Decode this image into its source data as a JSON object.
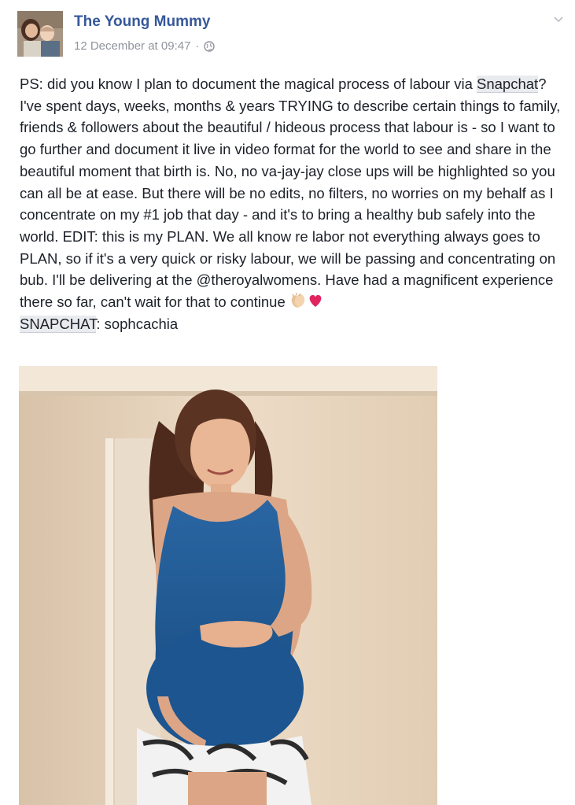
{
  "post": {
    "author": "The Young Mummy",
    "timestamp": "12 December at 09:47",
    "separator": "·",
    "text_parts": {
      "p1": "PS: did you know I plan to document the magical process of labour via ",
      "tag1": "Snapchat",
      "p2": "? I've spent days, weeks, months & years TRYING to describe certain things to family, friends & followers about the beautiful / hideous process that labour is - so I want to go further and document it live in video format for the world to see and share in the beautiful moment that birth is. No, no va-jay-jay close ups will be highlighted so you can all be at ease. But there will be no edits, no filters, no worries on my behalf as I concentrate on my #1 job that day - and it's to bring a healthy bub safely into the world. EDIT: this is my PLAN. We all know re labor not everything always goes to PLAN, so if it's a very quick or risky labour, we will be passing and concentrating on bub. I'll be delivering at the @theroyalwomens. Have had a magnificent experience there so far, can't wait for that to continue ",
      "tag2": "SNAPCHAT",
      "p3": ": sophcachia"
    }
  },
  "icons": {
    "globe": "globe-icon",
    "chevron": "chevron-down-icon",
    "clap": "clapping-hands-emoji",
    "heart": "red-heart-emoji"
  },
  "colors": {
    "author_link": "#365899",
    "meta_text": "#90949c",
    "body_text": "#1d2129",
    "tag_highlight": "#e9ebee",
    "heart": "#e0245e"
  }
}
